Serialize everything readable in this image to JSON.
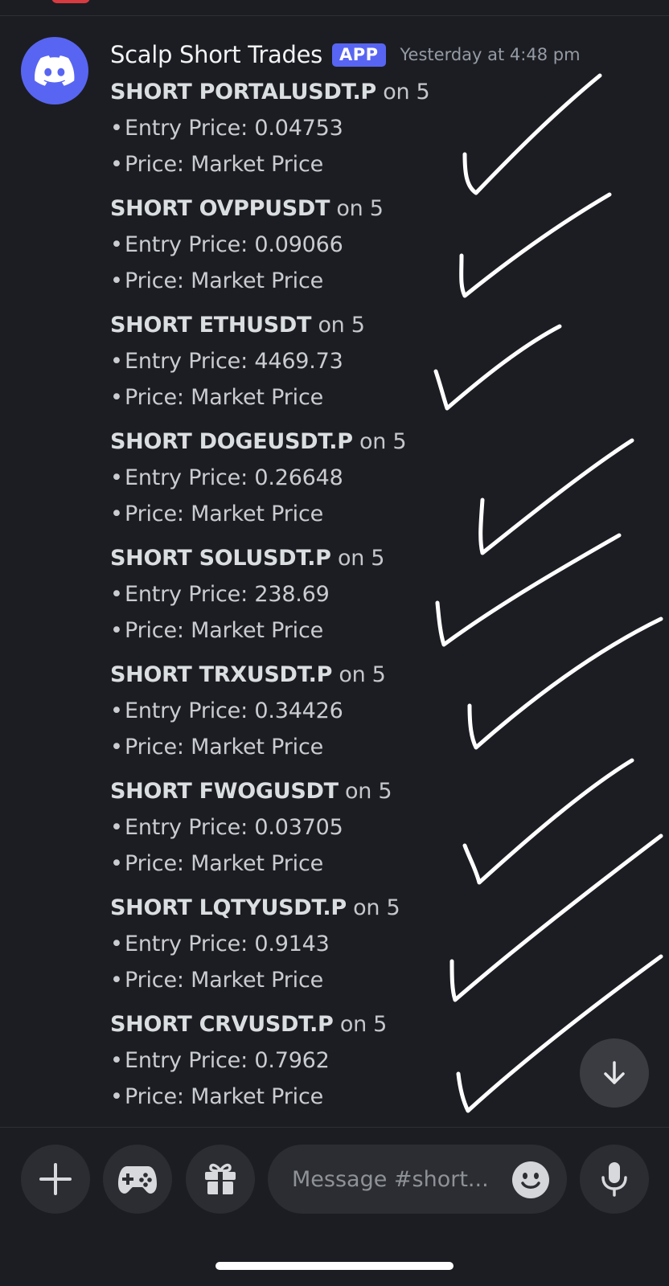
{
  "message": {
    "author": "Scalp Short Trades",
    "badge": "APP",
    "timestamp": "Yesterday at 4:48 pm",
    "avatar_icon": "discord-logo-icon",
    "bullet": "•",
    "trades": [
      {
        "direction_symbol": "SHORT PORTALUSDT.P",
        "timeframe": "on 5",
        "entry": "Entry Price: 0.04753",
        "price": "Price: Market Price"
      },
      {
        "direction_symbol": "SHORT OVPPUSDT",
        "timeframe": "on 5",
        "entry": "Entry Price: 0.09066",
        "price": "Price: Market Price"
      },
      {
        "direction_symbol": "SHORT ETHUSDT",
        "timeframe": "on 5",
        "entry": "Entry Price: 4469.73",
        "price": "Price: Market Price"
      },
      {
        "direction_symbol": "SHORT DOGEUSDT.P",
        "timeframe": "on 5",
        "entry": "Entry Price: 0.26648",
        "price": "Price: Market Price"
      },
      {
        "direction_symbol": "SHORT SOLUSDT.P",
        "timeframe": "on 5",
        "entry": "Entry Price: 238.69",
        "price": "Price: Market Price"
      },
      {
        "direction_symbol": "SHORT TRXUSDT.P",
        "timeframe": "on 5",
        "entry": "Entry Price: 0.34426",
        "price": "Price: Market Price"
      },
      {
        "direction_symbol": "SHORT FWOGUSDT",
        "timeframe": "on 5",
        "entry": "Entry Price: 0.03705",
        "price": "Price: Market Price"
      },
      {
        "direction_symbol": "SHORT LQTYUSDT.P",
        "timeframe": "on 5",
        "entry": "Entry Price: 0.9143",
        "price": "Price: Market Price"
      },
      {
        "direction_symbol": "SHORT CRVUSDT.P",
        "timeframe": "on 5",
        "entry": "Entry Price: 0.7962",
        "price": "Price: Market Price"
      }
    ]
  },
  "annotations": {
    "checkmark_count": 9,
    "checkmark_color": "#ffffff"
  },
  "composer": {
    "placeholder": "Message #short...",
    "icons": [
      "plus-icon",
      "gamepad-icon",
      "gift-icon",
      "emoji-icon",
      "microphone-icon"
    ]
  },
  "jump_button_icon": "arrow-down-icon",
  "colors": {
    "background": "#1c1d22",
    "blurple": "#5865f2",
    "button_bg": "#2b2d33",
    "text": "#dbdee1",
    "muted": "#949ba4"
  }
}
